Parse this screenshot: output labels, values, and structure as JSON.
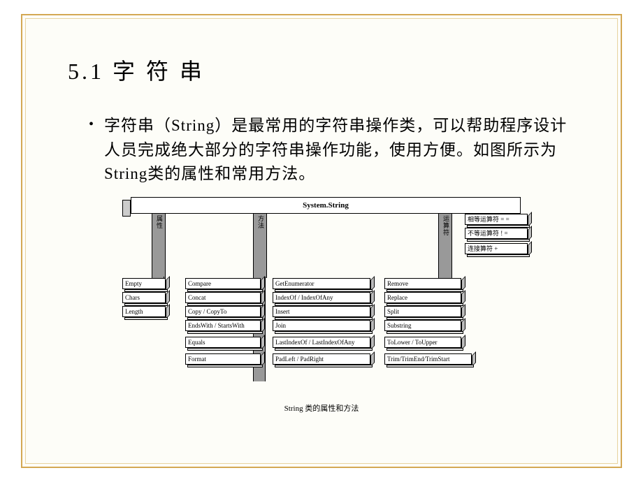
{
  "title": "5.1  字  符  串",
  "bullet_text": "字符串（String）是最常用的字符串操作类，可以帮助程序设计人员完成绝大部分的字符串操作功能，使用方便。如图所示为String类的属性和常用方法。",
  "diagram": {
    "header": "System.String",
    "pillars": {
      "p1": "属性",
      "p2": "方法",
      "p3": "运算符"
    },
    "operators": {
      "eq": "相等运算符 = =",
      "neq": "不等运算符 ! =",
      "concat": "连接算符 +"
    },
    "props": {
      "empty": "Empty",
      "chars": "Chars",
      "length": "Length"
    },
    "methods_col1": {
      "compare": "Compare",
      "concat": "Concat",
      "copy": "Copy / CopyTo",
      "ends": "EndsWith / StartsWith",
      "equals": "Equals",
      "format": "Format"
    },
    "methods_col2": {
      "getenum": "GetEnumerator",
      "indexof": "IndexOf / IndexOfAny",
      "insert": "Insert",
      "join": "Join",
      "lastindex": "LastIndexOf / LastIndexOfAny",
      "padleft": "PadLeft / PadRight"
    },
    "methods_col3": {
      "remove": "Remove",
      "replace": "Replace",
      "split": "Split",
      "substring": "Substring",
      "tolower": "ToLower / ToUpper",
      "trim": "Trim/TrimEnd/TrimStart"
    },
    "caption": "String 类的属性和方法"
  }
}
